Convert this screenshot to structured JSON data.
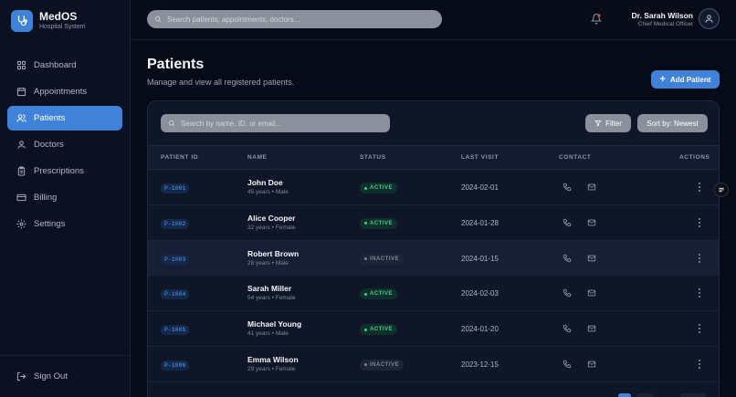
{
  "brand": {
    "name": "MedOS",
    "subtitle": "Hospital System"
  },
  "sidebar": {
    "items": [
      {
        "label": "Dashboard",
        "icon": "grid-icon",
        "active": false
      },
      {
        "label": "Appointments",
        "icon": "calendar-icon",
        "active": false
      },
      {
        "label": "Patients",
        "icon": "users-icon",
        "active": true
      },
      {
        "label": "Doctors",
        "icon": "user-icon",
        "active": false
      },
      {
        "label": "Prescriptions",
        "icon": "clipboard-icon",
        "active": false
      },
      {
        "label": "Billing",
        "icon": "credit-card-icon",
        "active": false
      },
      {
        "label": "Settings",
        "icon": "gear-icon",
        "active": false
      }
    ],
    "signout_label": "Sign Out"
  },
  "topbar": {
    "search_placeholder": "Search patients, appointments, doctors...",
    "user_name": "Dr. Sarah Wilson",
    "user_role": "Chief Medical Officer"
  },
  "page": {
    "title": "Patients",
    "subtitle": "Manage and view all registered patients.",
    "add_label": "Add Patient"
  },
  "table": {
    "search_placeholder": "Search by name, ID, or email...",
    "filter_label": "Filter",
    "sort_label": "Sort by: Newest",
    "headers": {
      "id": "PATIENT ID",
      "name": "NAME",
      "status": "STATUS",
      "last_visit": "LAST VISIT",
      "contact": "CONTACT",
      "actions": "ACTIONS"
    },
    "rows": [
      {
        "id": "P-1001",
        "name": "John Doe",
        "meta": "45 years • Male",
        "status": "ACTIVE",
        "last_visit": "2024-02-01"
      },
      {
        "id": "P-1002",
        "name": "Alice Cooper",
        "meta": "32 years • Female",
        "status": "ACTIVE",
        "last_visit": "2024-01-28"
      },
      {
        "id": "P-1003",
        "name": "Robert Brown",
        "meta": "28 years • Male",
        "status": "INACTIVE",
        "last_visit": "2024-01-15"
      },
      {
        "id": "P-1004",
        "name": "Sarah Miller",
        "meta": "54 years • Female",
        "status": "ACTIVE",
        "last_visit": "2024-02-03"
      },
      {
        "id": "P-1005",
        "name": "Michael Young",
        "meta": "41 years • Male",
        "status": "ACTIVE",
        "last_visit": "2024-01-20"
      },
      {
        "id": "P-1006",
        "name": "Emma Wilson",
        "meta": "29 years • Female",
        "status": "INACTIVE",
        "last_visit": "2023-12-15"
      }
    ]
  },
  "colors": {
    "accent": "#3f82d8",
    "background": "#070b17",
    "active_status": "#3fcf8e",
    "inactive_status": "#7a8599"
  }
}
